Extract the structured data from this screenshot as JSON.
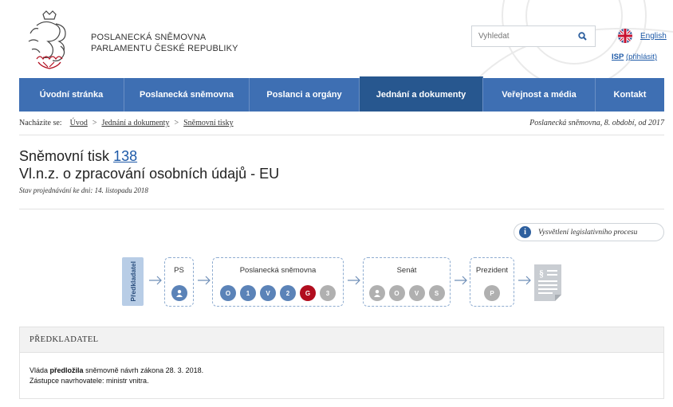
{
  "header": {
    "brand_line1": "POSLANECKÁ SNĚMOVNA",
    "brand_line2": "PARLAMENTU ČESKÉ REPUBLIKY",
    "search_placeholder": "Vyhledat",
    "lang_link": "English",
    "isp_link": "ISP",
    "isp_login": "(přihlásit)"
  },
  "nav": {
    "items": [
      {
        "label": "Úvodní stránka"
      },
      {
        "label": "Poslanecká sněmovna"
      },
      {
        "label": "Poslanci a orgány"
      },
      {
        "label": "Jednání a dokumenty"
      },
      {
        "label": "Veřejnost a média"
      },
      {
        "label": "Kontakt"
      }
    ],
    "active_index": 3
  },
  "breadcrumb": {
    "label": "Nacházíte se:",
    "items": [
      "Úvod",
      "Jednání a dokumenty",
      "Sněmovní tisky"
    ],
    "separator": ">",
    "right_text": "Poslanecká sněmovna, 8. období, od 2017"
  },
  "page": {
    "title_prefix": "Sněmovní tisk",
    "title_number": "138",
    "subtitle": "Vl.n.z. o zpracování osobních údajů - EU",
    "stav": "Stav projednávání ke dni: 14. listopadu 2018",
    "explain_label": "Vysvětlení legislativního procesu"
  },
  "process": {
    "predkladatel_label": "Předkladatel",
    "stages": [
      {
        "name": "PS",
        "steps": [
          {
            "label": "♟",
            "state": "blue"
          }
        ]
      },
      {
        "name": "Poslanecká sněmovna",
        "steps": [
          {
            "label": "O",
            "state": "blue"
          },
          {
            "label": "1",
            "state": "blue"
          },
          {
            "label": "V",
            "state": "blue"
          },
          {
            "label": "2",
            "state": "blue"
          },
          {
            "label": "G",
            "state": "red"
          },
          {
            "label": "3",
            "state": "gray"
          }
        ]
      },
      {
        "name": "Senát",
        "steps": [
          {
            "label": "♟",
            "state": "gray"
          },
          {
            "label": "O",
            "state": "gray"
          },
          {
            "label": "V",
            "state": "gray"
          },
          {
            "label": "S",
            "state": "gray"
          }
        ]
      },
      {
        "name": "Prezident",
        "steps": [
          {
            "label": "P",
            "state": "gray"
          }
        ]
      }
    ]
  },
  "panel": {
    "heading": "PŘEDKLADATEL",
    "line1_prefix": "Vláda",
    "line1_bold": "předložila",
    "line1_rest": "sněmovně návrh zákona 28. 3. 2018.",
    "line2": "Zástupce navrhovatele: ministr vnitra."
  },
  "colors": {
    "nav_blue": "#3e6fb3",
    "nav_active": "#27578f",
    "step_blue": "#5b83b8",
    "step_current": "#b10d1e",
    "step_pending": "#b0b0b0"
  }
}
